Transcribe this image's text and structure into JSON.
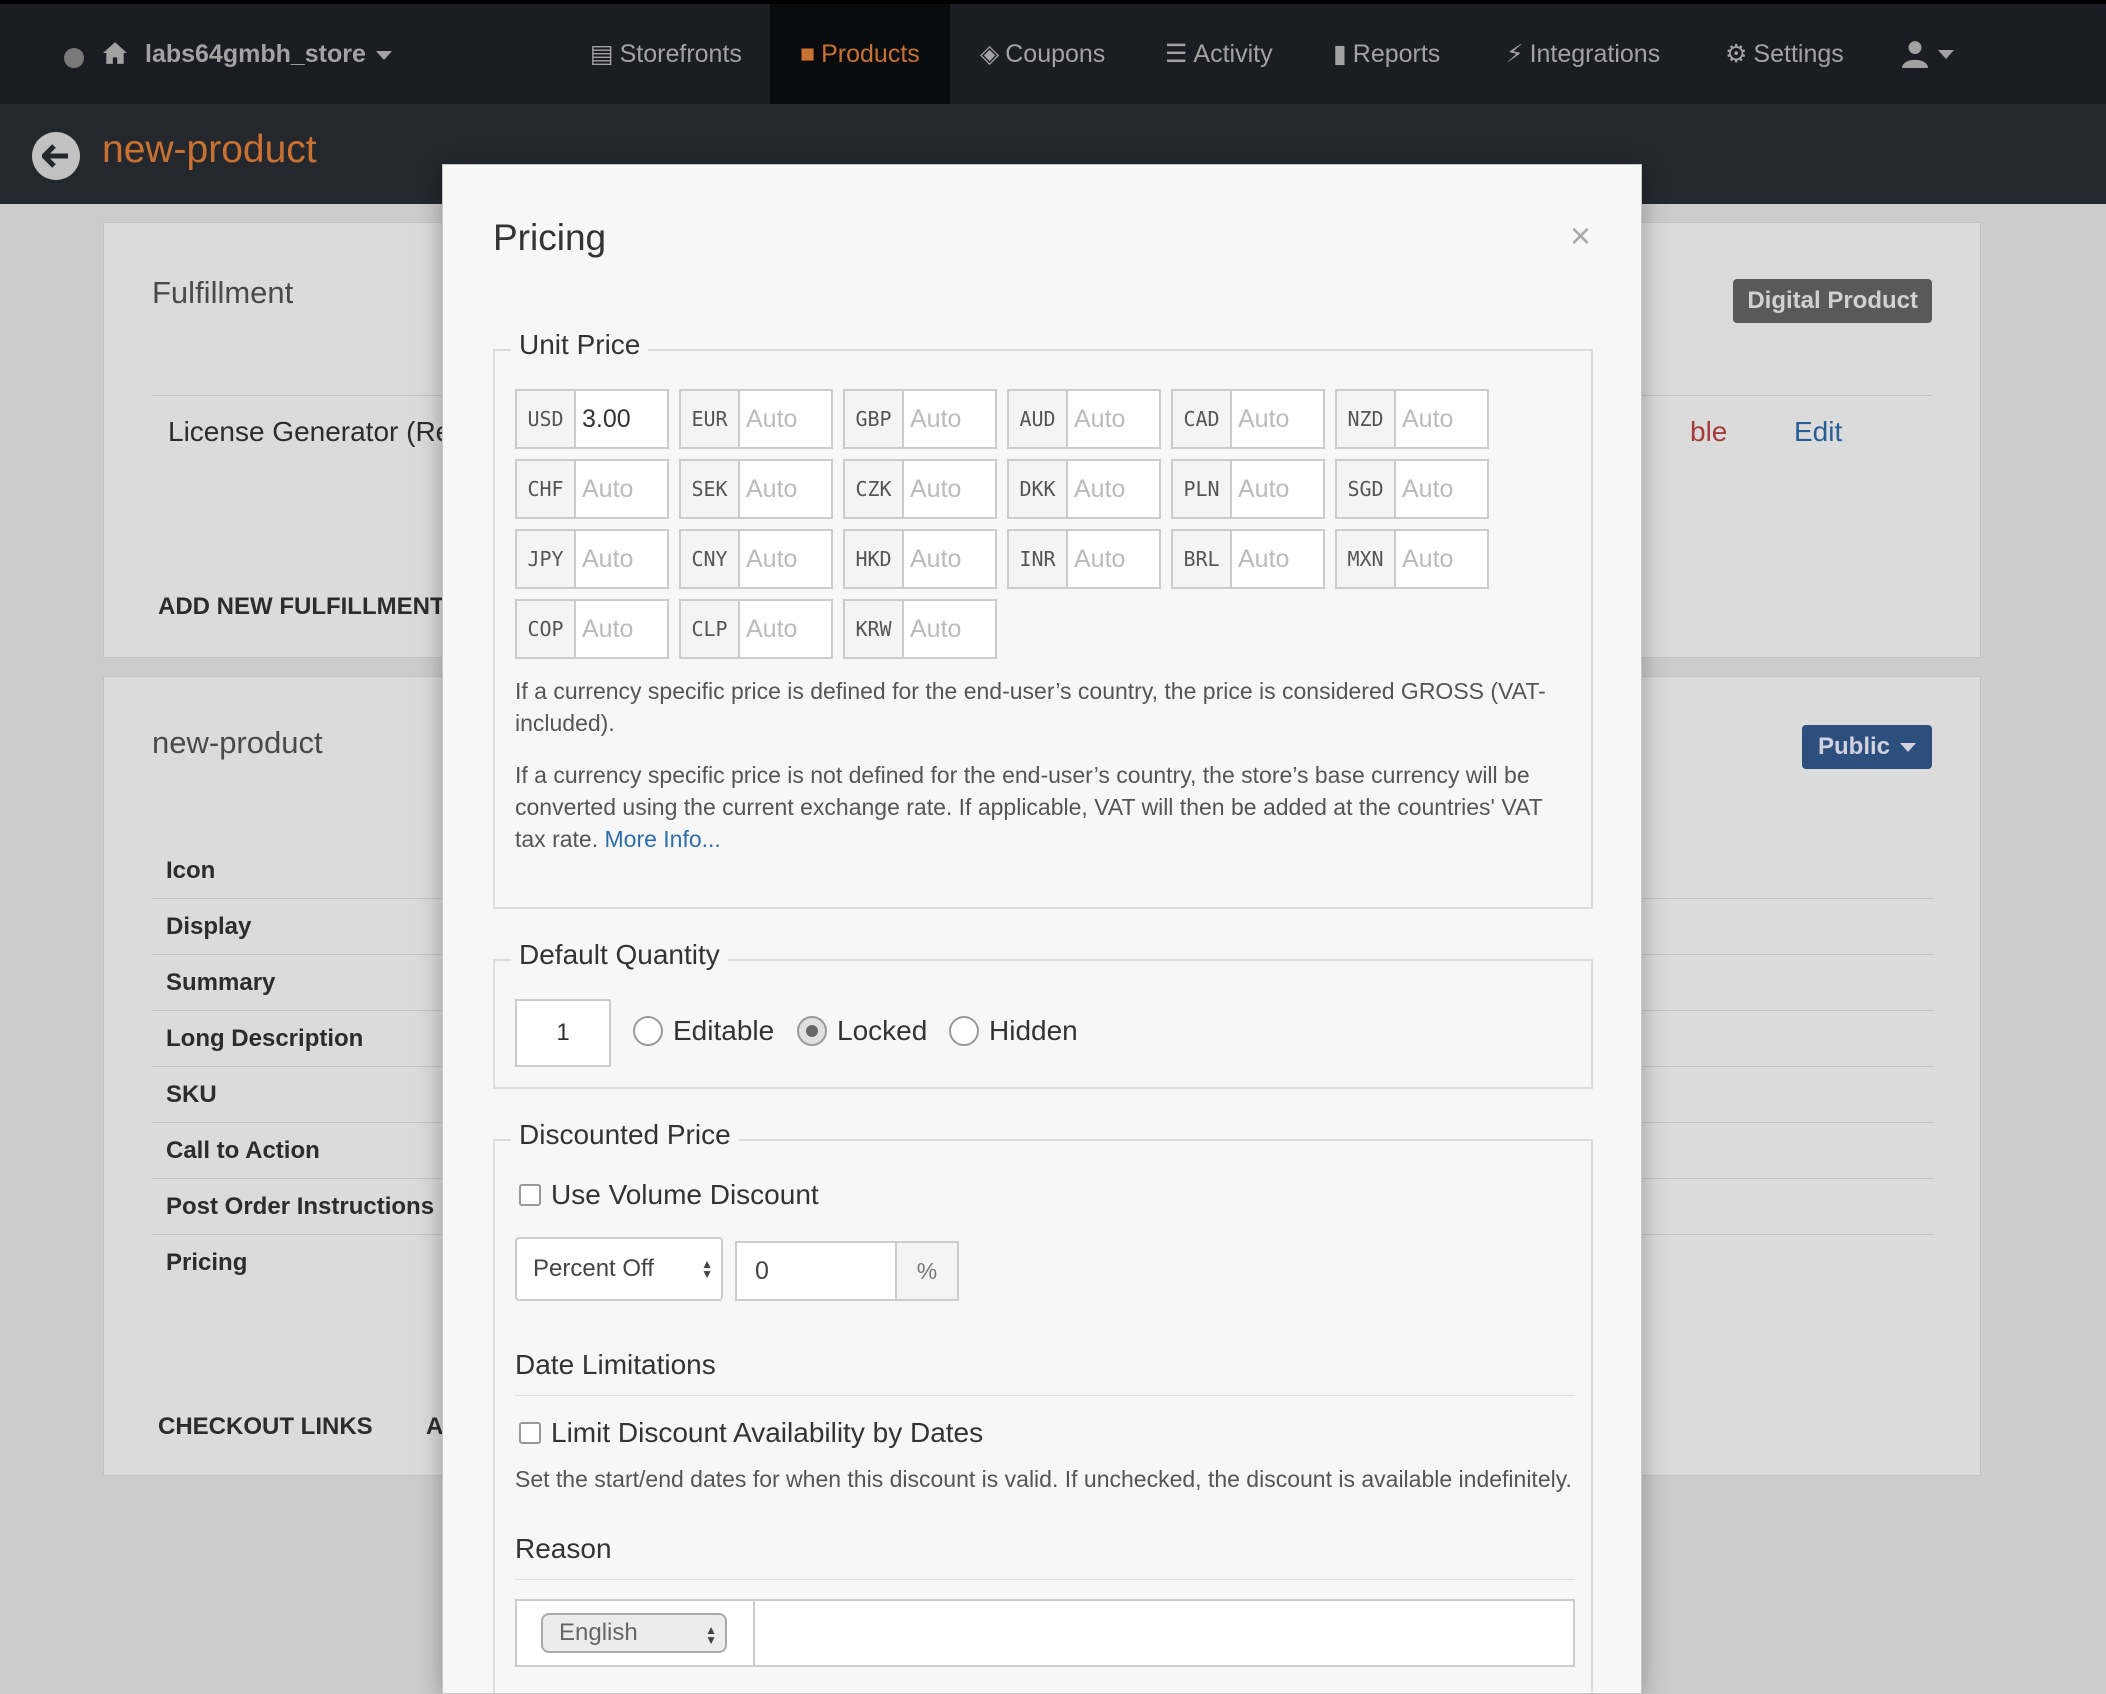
{
  "nav": {
    "store_name": "labs64gmbh_store",
    "items": [
      {
        "label": "Storefronts",
        "icon": "storefront-icon"
      },
      {
        "label": "Products",
        "icon": "briefcase-icon",
        "active": true
      },
      {
        "label": "Coupons",
        "icon": "tags-icon"
      },
      {
        "label": "Activity",
        "icon": "list-icon"
      },
      {
        "label": "Reports",
        "icon": "bar-chart-icon"
      },
      {
        "label": "Integrations",
        "icon": "plug-icon"
      },
      {
        "label": "Settings",
        "icon": "gear-icon"
      }
    ],
    "accent_color": "#e4813b"
  },
  "subheader": {
    "title": "new-product"
  },
  "fulfillment": {
    "title": "Fulfillment",
    "badge": "Digital Product",
    "row_label": "License Generator (Re",
    "row_status": "ble",
    "edit": "Edit",
    "add_new": "ADD NEW FULFILLMENT"
  },
  "product": {
    "title": "new-product",
    "badge": "Public",
    "rows": [
      "Icon",
      "Display",
      "Summary",
      "Long Description",
      "SKU",
      "Call to Action",
      "Post Order Instructions",
      "Pricing"
    ],
    "checkout_links": "CHECKOUT LINKS",
    "checkout_next": "A"
  },
  "modal": {
    "title": "Pricing",
    "close": "×",
    "unit_price": {
      "legend": "Unit Price",
      "currencies": [
        {
          "code": "USD",
          "value": "3.00"
        },
        {
          "code": "EUR",
          "placeholder": "Auto"
        },
        {
          "code": "GBP",
          "placeholder": "Auto"
        },
        {
          "code": "AUD",
          "placeholder": "Auto"
        },
        {
          "code": "CAD",
          "placeholder": "Auto"
        },
        {
          "code": "NZD",
          "placeholder": "Auto"
        },
        {
          "code": "CHF",
          "placeholder": "Auto"
        },
        {
          "code": "SEK",
          "placeholder": "Auto"
        },
        {
          "code": "CZK",
          "placeholder": "Auto"
        },
        {
          "code": "DKK",
          "placeholder": "Auto"
        },
        {
          "code": "PLN",
          "placeholder": "Auto"
        },
        {
          "code": "SGD",
          "placeholder": "Auto"
        },
        {
          "code": "JPY",
          "placeholder": "Auto"
        },
        {
          "code": "CNY",
          "placeholder": "Auto"
        },
        {
          "code": "HKD",
          "placeholder": "Auto"
        },
        {
          "code": "INR",
          "placeholder": "Auto"
        },
        {
          "code": "BRL",
          "placeholder": "Auto"
        },
        {
          "code": "MXN",
          "placeholder": "Auto"
        },
        {
          "code": "COP",
          "placeholder": "Auto"
        },
        {
          "code": "CLP",
          "placeholder": "Auto"
        },
        {
          "code": "KRW",
          "placeholder": "Auto"
        }
      ],
      "help1": "If a currency specific price is defined for the end-user’s country, the price is considered GROSS (VAT-included).",
      "help2": "If a currency specific price is not defined for the end-user’s country, the store’s base currency will be converted using the current exchange rate. If applicable, VAT will then be added at the countries' VAT tax rate.",
      "more_info": "More Info..."
    },
    "default_quantity": {
      "legend": "Default Quantity",
      "value": "1",
      "options": [
        "Editable",
        "Locked",
        "Hidden"
      ],
      "selected": "Locked"
    },
    "discounted_price": {
      "legend": "Discounted Price",
      "use_volume_discount": "Use Volume Discount",
      "discount_type": "Percent Off",
      "discount_value": "0",
      "discount_unit": "%",
      "date_limitations": "Date Limitations",
      "limit_by_dates": "Limit Discount Availability by Dates",
      "date_help": "Set the start/end dates for when this discount is valid. If unchecked, the discount is available indefinitely.",
      "reason": "Reason",
      "language": "English"
    }
  }
}
